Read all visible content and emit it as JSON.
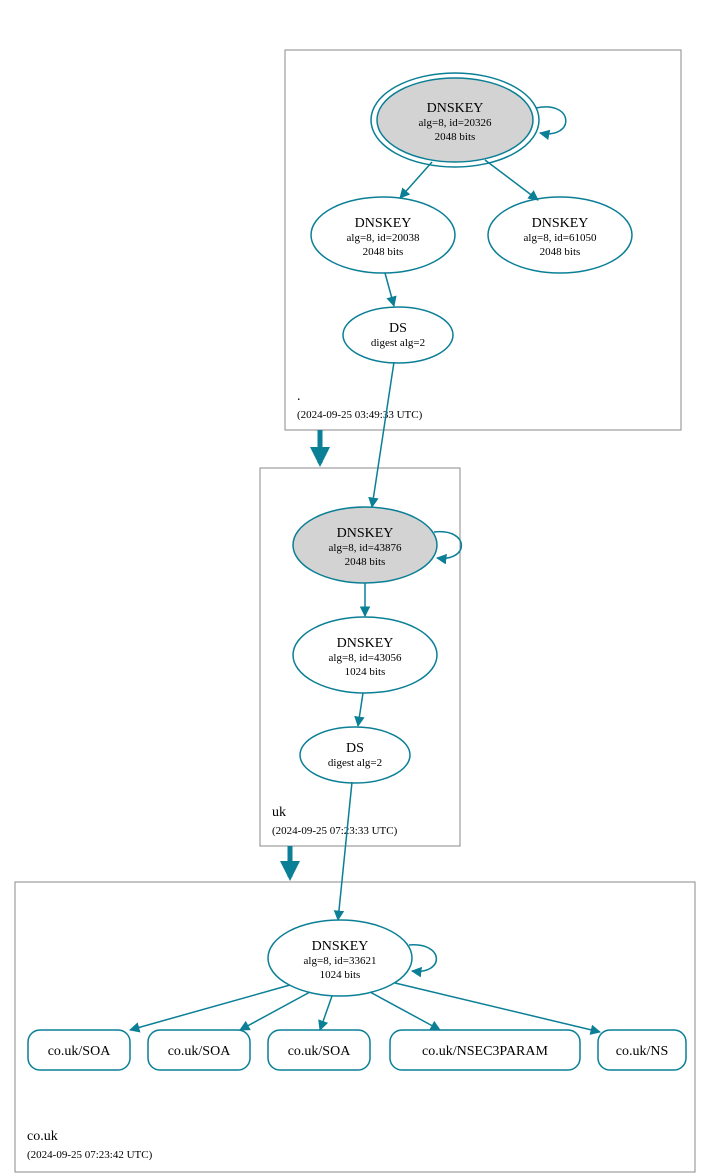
{
  "colors": {
    "stroke": "#0a7f96",
    "shade": "#d3d3d3",
    "box": "#888888"
  },
  "zones": {
    "root": {
      "name": ".",
      "timestamp": "(2024-09-25 03:49:33 UTC)"
    },
    "uk": {
      "name": "uk",
      "timestamp": "(2024-09-25 07:23:33 UTC)"
    },
    "couk": {
      "name": "co.uk",
      "timestamp": "(2024-09-25 07:23:42 UTC)"
    }
  },
  "nodes": {
    "root_ksk": {
      "title": "DNSKEY",
      "line1": "alg=8, id=20326",
      "line2": "2048 bits"
    },
    "root_zsk": {
      "title": "DNSKEY",
      "line1": "alg=8, id=20038",
      "line2": "2048 bits"
    },
    "root_zsk2": {
      "title": "DNSKEY",
      "line1": "alg=8, id=61050",
      "line2": "2048 bits"
    },
    "root_ds": {
      "title": "DS",
      "line1": "digest alg=2"
    },
    "uk_ksk": {
      "title": "DNSKEY",
      "line1": "alg=8, id=43876",
      "line2": "2048 bits"
    },
    "uk_zsk": {
      "title": "DNSKEY",
      "line1": "alg=8, id=43056",
      "line2": "1024 bits"
    },
    "uk_ds": {
      "title": "DS",
      "line1": "digest alg=2"
    },
    "couk_zsk": {
      "title": "DNSKEY",
      "line1": "alg=8, id=33621",
      "line2": "1024 bits"
    }
  },
  "leaves": {
    "soa1": "co.uk/SOA",
    "soa2": "co.uk/SOA",
    "soa3": "co.uk/SOA",
    "nsec3": "co.uk/NSEC3PARAM",
    "ns": "co.uk/NS"
  }
}
